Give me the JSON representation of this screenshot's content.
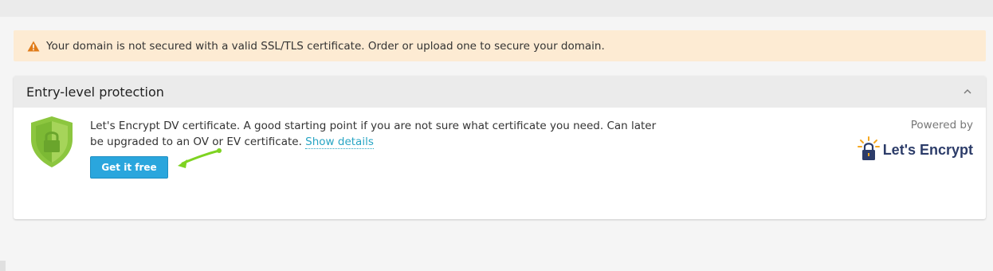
{
  "alert": {
    "text": "Your domain is not secured with a valid SSL/TLS certificate. Order or upload one to secure your domain.",
    "icon": "warning-icon",
    "color": "#e07b18"
  },
  "panel": {
    "title": "Entry-level protection",
    "description": "Let's Encrypt DV certificate. A good starting point if you are not sure what certificate you need. Can later be upgraded to an OV or EV certificate.",
    "details_link": "Show details",
    "button_label": "Get it free",
    "powered_by": "Powered by",
    "provider": "Let's Encrypt"
  },
  "colors": {
    "accent": "#2aa6dd",
    "shield": "#8cc63f",
    "link": "#28a5c4",
    "annotation_arrow": "#7ed321",
    "provider_text": "#2c3c69",
    "provider_sun": "#f6a821"
  }
}
